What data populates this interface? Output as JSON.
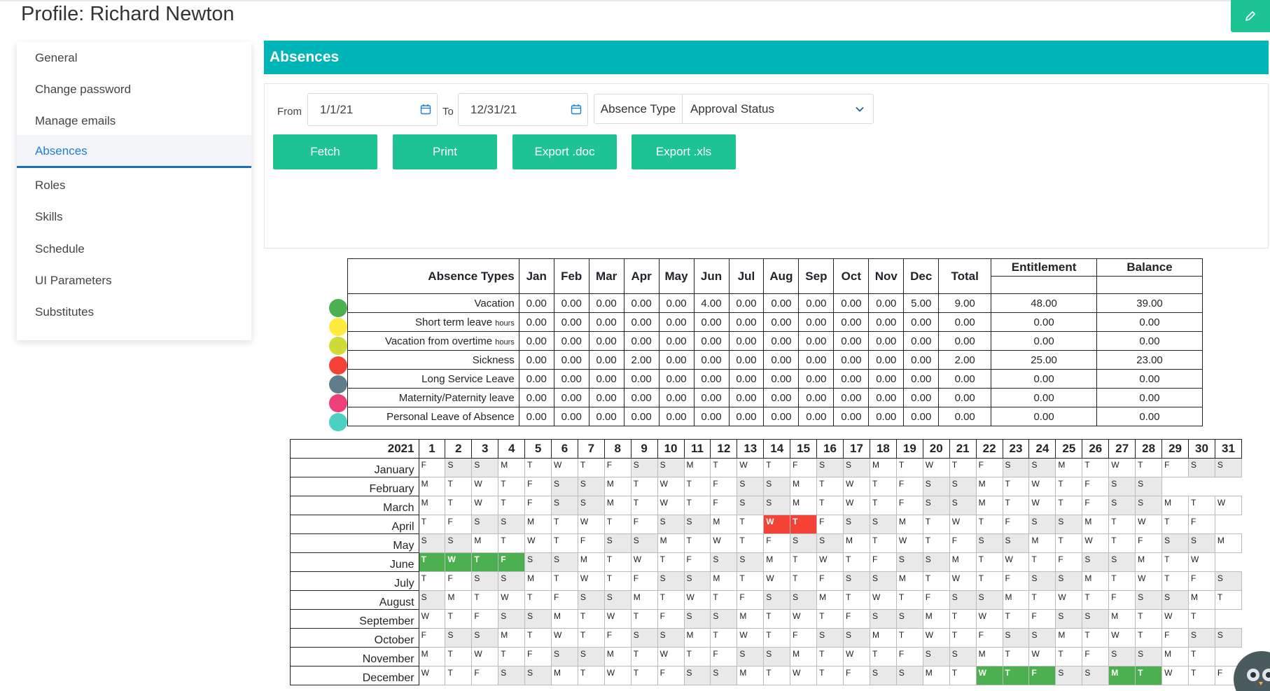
{
  "page": {
    "title": "Profile: Richard Newton"
  },
  "sidebar": {
    "items": [
      {
        "label": "General"
      },
      {
        "label": "Change password"
      },
      {
        "label": "Manage emails"
      },
      {
        "label": "Absences",
        "active": true
      },
      {
        "label": "Roles"
      },
      {
        "label": "Skills"
      },
      {
        "label": "Schedule"
      },
      {
        "label": "UI Parameters"
      },
      {
        "label": "Substitutes"
      }
    ]
  },
  "panel": {
    "title": "Absences"
  },
  "filters": {
    "from_label": "From",
    "from_value": "1/1/21",
    "to_label": "To",
    "to_value": "12/31/21",
    "absence_type_label": "Absence Type",
    "approval_status_value": "Approval Status"
  },
  "buttons": {
    "fetch": "Fetch",
    "print": "Print",
    "export_doc": "Export .doc",
    "export_xls": "Export .xls"
  },
  "summary": {
    "headers": [
      "Absence Types",
      "Jan",
      "Feb",
      "Mar",
      "Apr",
      "May",
      "Jun",
      "Jul",
      "Aug",
      "Sep",
      "Oct",
      "Nov",
      "Dec",
      "Total",
      "Entitlement",
      "Balance"
    ],
    "rows": [
      {
        "type": "Vacation",
        "unit": "",
        "color": "#4caf50",
        "values": [
          "0.00",
          "0.00",
          "0.00",
          "0.00",
          "0.00",
          "4.00",
          "0.00",
          "0.00",
          "0.00",
          "0.00",
          "0.00",
          "5.00",
          "9.00",
          "48.00",
          "39.00"
        ]
      },
      {
        "type": "Short term leave",
        "unit": "hours",
        "color": "#ffeb3b",
        "values": [
          "0.00",
          "0.00",
          "0.00",
          "0.00",
          "0.00",
          "0.00",
          "0.00",
          "0.00",
          "0.00",
          "0.00",
          "0.00",
          "0.00",
          "0.00",
          "0.00",
          "0.00"
        ]
      },
      {
        "type": "Vacation from overtime",
        "unit": "hours",
        "color": "#cddc39",
        "values": [
          "0.00",
          "0.00",
          "0.00",
          "0.00",
          "0.00",
          "0.00",
          "0.00",
          "0.00",
          "0.00",
          "0.00",
          "0.00",
          "0.00",
          "0.00",
          "0.00",
          "0.00"
        ]
      },
      {
        "type": "Sickness",
        "unit": "",
        "color": "#f44336",
        "values": [
          "0.00",
          "0.00",
          "0.00",
          "2.00",
          "0.00",
          "0.00",
          "0.00",
          "0.00",
          "0.00",
          "0.00",
          "0.00",
          "0.00",
          "2.00",
          "25.00",
          "23.00"
        ]
      },
      {
        "type": "Long Service Leave",
        "unit": "",
        "color": "#607d8b",
        "values": [
          "0.00",
          "0.00",
          "0.00",
          "0.00",
          "0.00",
          "0.00",
          "0.00",
          "0.00",
          "0.00",
          "0.00",
          "0.00",
          "0.00",
          "0.00",
          "0.00",
          "0.00"
        ]
      },
      {
        "type": "Maternity/Paternity leave",
        "unit": "",
        "color": "#ec407a",
        "values": [
          "0.00",
          "0.00",
          "0.00",
          "0.00",
          "0.00",
          "0.00",
          "0.00",
          "0.00",
          "0.00",
          "0.00",
          "0.00",
          "0.00",
          "0.00",
          "0.00",
          "0.00"
        ]
      },
      {
        "type": "Personal Leave of Absence",
        "unit": "",
        "color": "#4dd0c4",
        "values": [
          "0.00",
          "0.00",
          "0.00",
          "0.00",
          "0.00",
          "0.00",
          "0.00",
          "0.00",
          "0.00",
          "0.00",
          "0.00",
          "0.00",
          "0.00",
          "0.00",
          "0.00"
        ]
      }
    ]
  },
  "calendar": {
    "year": "2021",
    "days": [
      "1",
      "2",
      "3",
      "4",
      "5",
      "6",
      "7",
      "8",
      "9",
      "10",
      "11",
      "12",
      "13",
      "14",
      "15",
      "16",
      "17",
      "18",
      "19",
      "20",
      "21",
      "22",
      "23",
      "24",
      "25",
      "26",
      "27",
      "28",
      "29",
      "30",
      "31"
    ],
    "months": [
      {
        "name": "January",
        "start": 5,
        "length": 31
      },
      {
        "name": "February",
        "start": 1,
        "length": 28
      },
      {
        "name": "March",
        "start": 1,
        "length": 31
      },
      {
        "name": "April",
        "start": 4,
        "length": 30,
        "sick": [
          14,
          15
        ]
      },
      {
        "name": "May",
        "start": 6,
        "length": 31
      },
      {
        "name": "June",
        "start": 2,
        "length": 30,
        "vacation": [
          1,
          2,
          3,
          4
        ]
      },
      {
        "name": "July",
        "start": 4,
        "length": 31
      },
      {
        "name": "August",
        "start": 0,
        "length": 31
      },
      {
        "name": "September",
        "start": 3,
        "length": 30
      },
      {
        "name": "October",
        "start": 5,
        "length": 31
      },
      {
        "name": "November",
        "start": 1,
        "length": 30
      },
      {
        "name": "December",
        "start": 3,
        "length": 31,
        "vacation": [
          22,
          23,
          24,
          27,
          28
        ]
      }
    ]
  },
  "colors": {
    "accent": "#00b5b8",
    "button": "#1ec393",
    "active_link": "#1e7fd6",
    "weekend": "#e9e9e9",
    "vacation": "#4caf50",
    "sickness": "#f44336"
  }
}
